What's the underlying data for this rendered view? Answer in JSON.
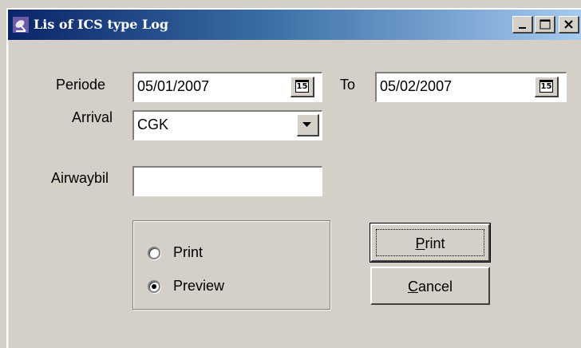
{
  "window": {
    "title": "Lis of ICS type Log",
    "app_icon": "satellite-dish-icon",
    "controls": [
      "minimize-icon",
      "maximize-icon",
      "close-icon"
    ]
  },
  "form": {
    "periode_label": "Periode",
    "periode_from": "05/01/2007",
    "to_label": "To",
    "periode_to": "05/02/2007",
    "calendar_glyph": "15",
    "arrival_label": "Arrival",
    "arrival_value": "CGK",
    "airwaybil_label": "Airwaybil",
    "airwaybil_value": ""
  },
  "output_options": {
    "options": [
      {
        "label": "Print",
        "selected": false
      },
      {
        "label": "Preview",
        "selected": true
      }
    ]
  },
  "buttons": {
    "print": {
      "accel": "P",
      "rest": "rint"
    },
    "cancel": {
      "accel": "C",
      "rest": "ancel"
    }
  }
}
